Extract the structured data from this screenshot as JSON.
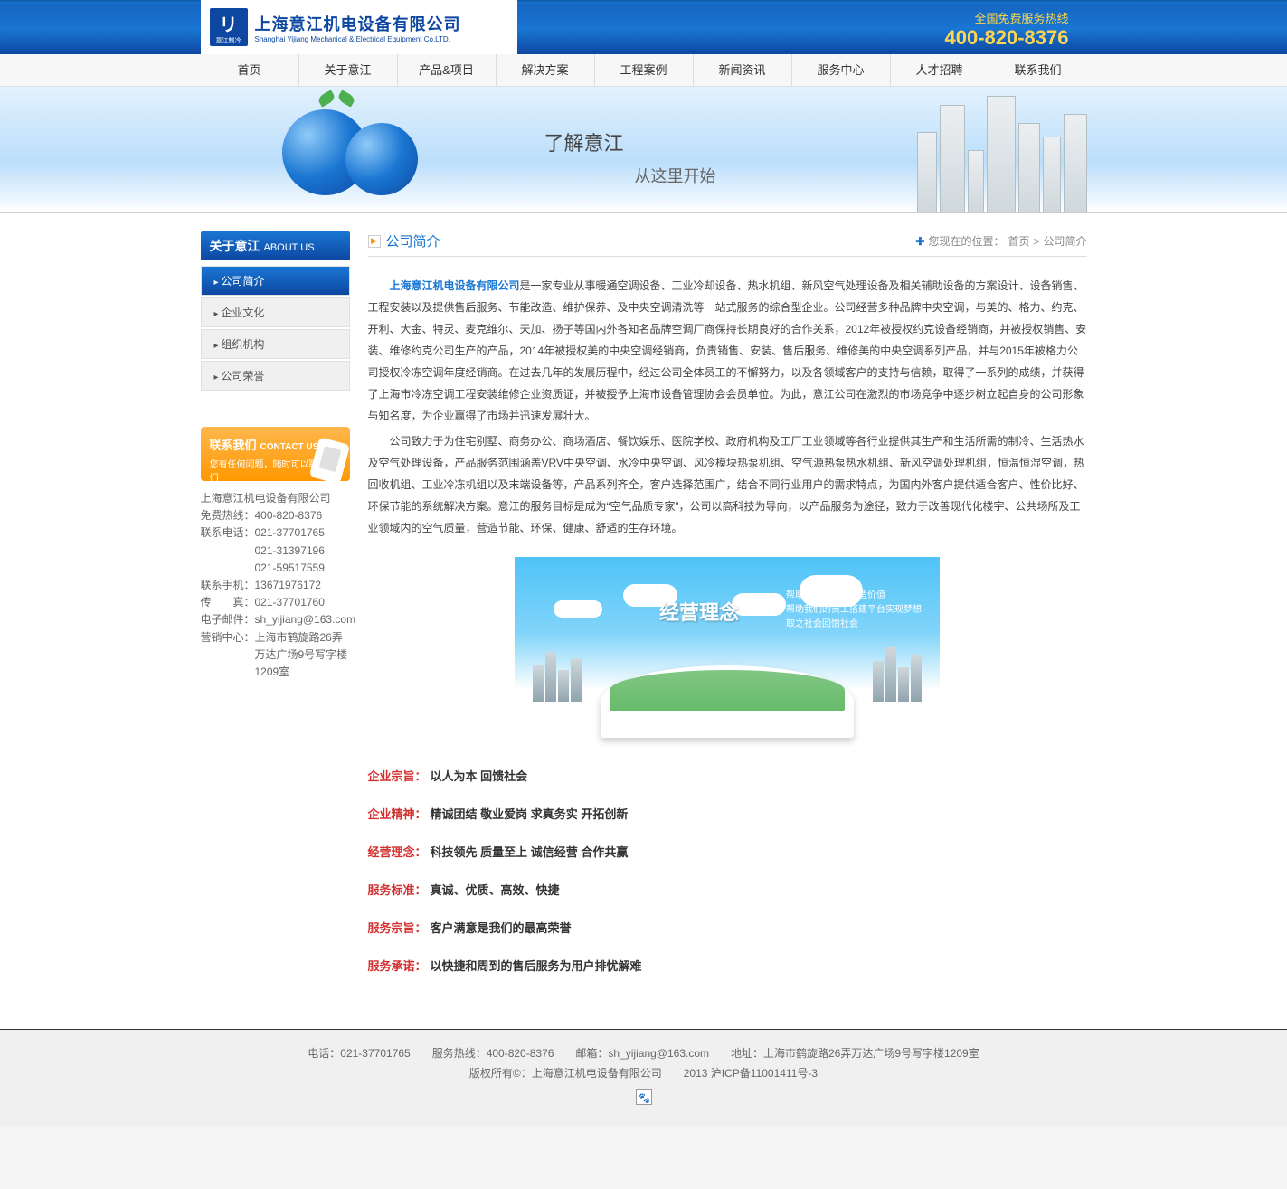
{
  "header": {
    "logo_cn": "上海意江机电设备有限公司",
    "logo_en": "Shanghai Yijiang Mechanical & Electrical Equipment Co.LTD.",
    "logo_badge": "リ",
    "logo_badge_sub": "意江制冷",
    "hotline_label": "全国免费服务热线",
    "hotline_number": "400-820-8376"
  },
  "nav": [
    "首页",
    "关于意江",
    "产品&项目",
    "解决方案",
    "工程案例",
    "新闻资讯",
    "服务中心",
    "人才招聘",
    "联系我们"
  ],
  "banner": {
    "line1": "了解意江",
    "line2": "从这里开始"
  },
  "sidebar": {
    "title_cn": "关于意江",
    "title_en": "ABOUT US",
    "items": [
      "公司简介",
      "企业文化",
      "组织机构",
      "公司荣誉"
    ],
    "contact_title": "联系我们",
    "contact_en": "CONTACT US",
    "contact_sub": "您有任何问题，随时可以联系我们"
  },
  "contact": {
    "company": "上海意江机电设备有限公司",
    "rows": [
      {
        "lbl": "免费热线：",
        "val": "400-820-8376"
      },
      {
        "lbl": "联系电话：",
        "val": "021-37701765"
      },
      {
        "lbl": "",
        "val": "021-31397196"
      },
      {
        "lbl": "",
        "val": "021-59517559"
      },
      {
        "lbl": "联系手机：",
        "val": "13671976172"
      },
      {
        "lbl": "传　　真：",
        "val": "021-37701760"
      },
      {
        "lbl": "电子邮件：",
        "val": "sh_yijiang@163.com"
      },
      {
        "lbl": "营销中心：",
        "val": "上海市鹤旋路26弄万达广场9号写字楼1209室"
      }
    ]
  },
  "main": {
    "title": "公司简介",
    "breadcrumb": {
      "prefix": "您现在的位置：",
      "home": "首页",
      "sep": ">",
      "current": "公司简介"
    },
    "company_name": "上海意江机电设备有限公司",
    "para1": "是一家专业从事暖通空调设备、工业冷却设备、热水机组、新风空气处理设备及相关辅助设备的方案设计、设备销售、工程安装以及提供售后服务、节能改造、维护保养、及中央空调清洗等一站式服务的综合型企业。公司经营多种品牌中央空调，与美的、格力、约克、开利、大金、特灵、麦克维尔、天加、扬子等国内外各知名品牌空调厂商保持长期良好的合作关系，2012年被授权约克设备经销商，并被授权销售、安装、维修约克公司生产的产品，2014年被授权美的中央空调经销商，负责销售、安装、售后服务、维修美的中央空调系列产品，并与2015年被格力公司授权冷冻空调年度经销商。在过去几年的发展历程中，经过公司全体员工的不懈努力，以及各领域客户的支持与信赖，取得了一系列的成绩，并获得了上海市冷冻空调工程安装维修企业资质证，并被授予上海市设备管理协会会员单位。为此，意江公司在激烈的市场竞争中逐步树立起自身的公司形象与知名度，为企业赢得了市场并迅速发展壮大。",
    "para2": "公司致力于为住宅别墅、商务办公、商场酒店、餐饮娱乐、医院学校、政府机构及工厂工业领域等各行业提供其生产和生活所需的制冷、生活热水及空气处理设备，产品服务范围涵盖VRV中央空调、水冷中央空调、风冷模块热泵机组、空气源热泵热水机组、新风空调处理机组，恒温恒湿空调，热回收机组、工业冷冻机组以及末端设备等，产品系列齐全，客户选择范围广，结合不同行业用户的需求特点，为国内外客户提供适合客户、性价比好、环保节能的系统解决方案。意江的服务目标是成为“空气品质专家”，公司以高科技为导向，以产品服务为途径，致力于改善现代化楼宇、公共场所及工业领域内的空气质量，营造节能、环保、健康、舒适的生存环境。",
    "philosophy": {
      "title": "经营理念",
      "lines": [
        "帮助我们的用户创造价值",
        "帮助我们的员工搭建平台实现梦想",
        "取之社会回馈社会"
      ]
    },
    "values": [
      {
        "label": "企业宗旨：",
        "text": "以人为本 回馈社会"
      },
      {
        "label": "企业精神：",
        "text": "精诚团结 敬业爱岗 求真务实 开拓创新"
      },
      {
        "label": "经营理念：",
        "text": "科技领先 质量至上 诚信经营 合作共赢"
      },
      {
        "label": "服务标准：",
        "text": "真诚、优质、高效、快捷"
      },
      {
        "label": "服务宗旨：",
        "text": "客户满意是我们的最高荣誉"
      },
      {
        "label": "服务承诺：",
        "text": "以快捷和周到的售后服务为用户排忧解难"
      }
    ]
  },
  "footer": {
    "line1": "电话：021-37701765　　服务热线：400-820-8376　　邮箱：sh_yijiang@163.com　　地址：上海市鹤旋路26弄万达广场9号写字楼1209室",
    "line2": "版权所有©：上海意江机电设备有限公司　　2013 沪ICP备11001411号-3"
  }
}
